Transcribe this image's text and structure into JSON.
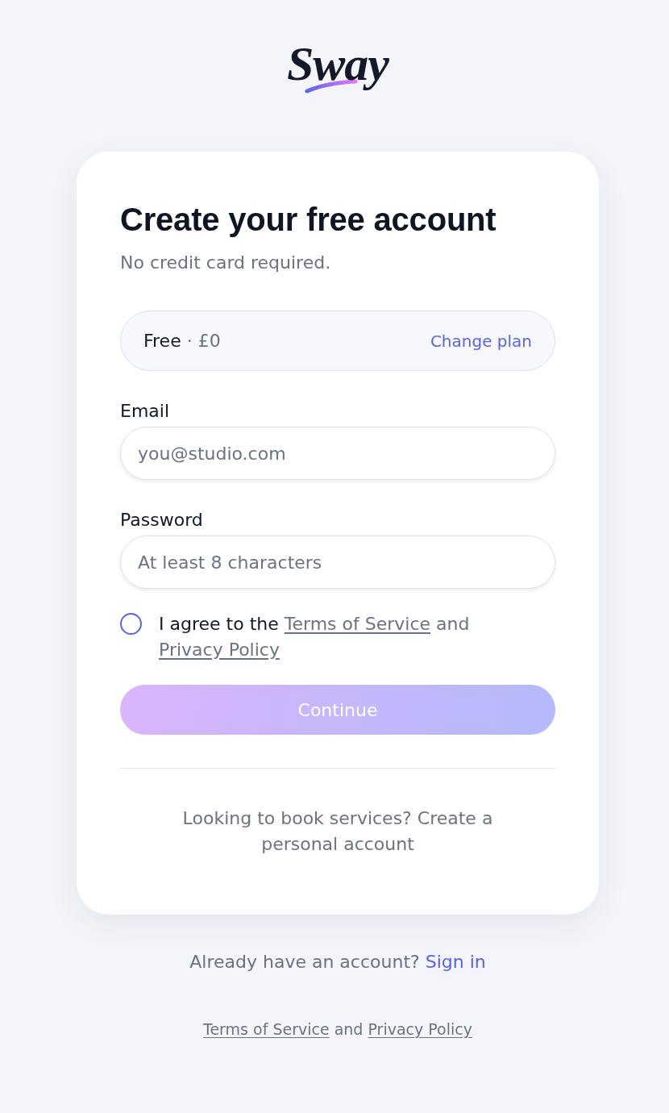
{
  "logo": {
    "text": "Sway"
  },
  "card": {
    "title": "Create your free account",
    "subtitle": "No credit card required.",
    "plan": {
      "name": "Free",
      "separator": "·",
      "price": "£0",
      "action": "Change plan"
    },
    "fields": [
      {
        "label": "Email",
        "placeholder": "you@studio.com"
      },
      {
        "label": "Password",
        "placeholder": "At least 8 characters"
      }
    ],
    "agreement": {
      "checked": false,
      "text": "I agree to the",
      "link_1": "Terms of Service",
      "joiner": "and",
      "link_2": "Privacy Policy"
    },
    "continue_button": {
      "label": "Continue",
      "disabled": true
    },
    "footer_note": "Looking to book services? Create a personal account"
  },
  "sign_in": {
    "text": "Already have an account?",
    "link": "Sign in"
  },
  "legal": {
    "link_1": "Terms of Service",
    "joiner": "and",
    "link_2": "Privacy Policy"
  }
}
